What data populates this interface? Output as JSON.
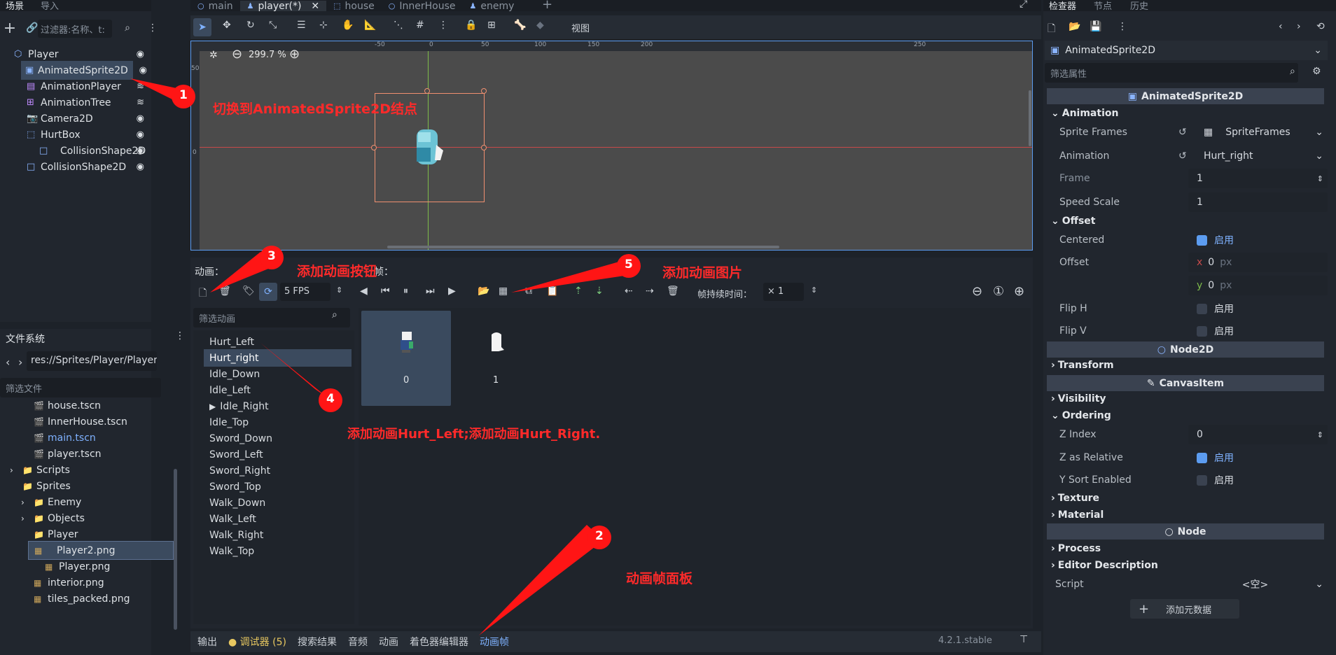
{
  "left_dock": {
    "tabs": [
      "场景",
      "导入"
    ],
    "filter_placeholder": "过滤器:名称、t:"
  },
  "scene_tree": [
    {
      "name": "Player",
      "icon": "node2d-icon",
      "level": 0,
      "visible": true
    },
    {
      "name": "AnimatedSprite2D",
      "icon": "animated-sprite-icon",
      "level": 1,
      "visible": true,
      "selected": true
    },
    {
      "name": "AnimationPlayer",
      "icon": "animation-player-icon",
      "level": 1,
      "visible": false
    },
    {
      "name": "AnimationTree",
      "icon": "animation-tree-icon",
      "level": 1,
      "visible": false
    },
    {
      "name": "Camera2D",
      "icon": "camera-icon",
      "level": 1,
      "visible": true
    },
    {
      "name": "HurtBox",
      "icon": "area2d-icon",
      "level": 1,
      "visible": true
    },
    {
      "name": "CollisionShape2D",
      "icon": "collision-shape-icon",
      "level": 2,
      "visible": true
    },
    {
      "name": "CollisionShape2D",
      "icon": "collision-shape-icon",
      "level": 1,
      "visible": true
    }
  ],
  "filesystem": {
    "title": "文件系统",
    "path": "res://Sprites/Player/Player",
    "filter_placeholder": "筛选文件",
    "items": [
      {
        "name": "house.tscn",
        "icon": "scene-icon",
        "level": 2
      },
      {
        "name": "InnerHouse.tscn",
        "icon": "scene-icon",
        "level": 2
      },
      {
        "name": "main.tscn",
        "icon": "scene-icon",
        "level": 2,
        "highlight": true
      },
      {
        "name": "player.tscn",
        "icon": "scene-icon",
        "level": 2
      },
      {
        "name": "Scripts",
        "icon": "folder-icon",
        "level": 1,
        "collapsed": true
      },
      {
        "name": "Sprites",
        "icon": "folder-icon",
        "level": 1
      },
      {
        "name": "Enemy",
        "icon": "folder-icon",
        "level": 2,
        "collapsed": true
      },
      {
        "name": "Objects",
        "icon": "folder-icon",
        "level": 2,
        "collapsed": true
      },
      {
        "name": "Player",
        "icon": "folder-icon",
        "level": 2
      },
      {
        "name": "Player2.png",
        "icon": "image-icon",
        "level": 3,
        "selected": true
      },
      {
        "name": "Player.png",
        "icon": "image-icon",
        "level": 3
      },
      {
        "name": "interior.png",
        "icon": "image-icon",
        "level": 2
      },
      {
        "name": "tiles_packed.png",
        "icon": "image-icon",
        "level": 2
      }
    ]
  },
  "editor_tabs": [
    "main",
    "player(*)",
    "house",
    "InnerHouse",
    "enemy"
  ],
  "viewport": {
    "toolbar_view": "视图",
    "zoom": "299.7 %",
    "ruler": [
      "-50",
      "0",
      "50",
      "100",
      "150",
      "200",
      "250"
    ],
    "ruler_v": [
      "50",
      "0"
    ]
  },
  "anim_panel": {
    "title": "动画：",
    "frames_label_partial": "帧：",
    "fps": "5 FPS",
    "frame_duration_label": "帧持续时间：",
    "frame_duration": "× 1",
    "filter_placeholder": "筛选动画",
    "animations": [
      "Hurt_Left",
      "Hurt_right",
      "Idle_Down",
      "Idle_Left",
      "Idle_Right",
      "Idle_Top",
      "Sword_Down",
      "Sword_Left",
      "Sword_Right",
      "Sword_Top",
      "Walk_Down",
      "Walk_Left",
      "Walk_Right",
      "Walk_Top"
    ],
    "selected_index": 1,
    "autoplay_index": 4,
    "frames": [
      "0",
      "1"
    ]
  },
  "bottom_bar": {
    "tabs": [
      "输出",
      "调试器 (5)",
      "搜索结果",
      "音频",
      "动画",
      "着色器编辑器",
      "动画帧"
    ],
    "version": "4.2.1.stable"
  },
  "inspector": {
    "tabs": [
      "检查器",
      "节点",
      "历史"
    ],
    "node": "AnimatedSprite2D",
    "filter_placeholder": "筛选属性",
    "sprite_frames": "SpriteFrames",
    "animation": "Hurt_right",
    "frame": "1",
    "speed_scale": "1",
    "centered": "启用",
    "offset_x": "0",
    "offset_y": "0",
    "px": "px",
    "on_label": "启用",
    "z_index": "0",
    "script_value": "<空>",
    "add_meta": "添加元数据",
    "labels": {
      "animated": "AnimatedSprite2D",
      "animation_sec": "Animation",
      "sprite_frames": "Sprite Frames",
      "animation": "Animation",
      "frame": "Frame",
      "speed_scale": "Speed Scale",
      "offset_sec": "Offset",
      "centered": "Centered",
      "offset": "Offset",
      "flip_h": "Flip H",
      "flip_v": "Flip V",
      "node2d": "Node2D",
      "transform": "Transform",
      "canvasitem": "CanvasItem",
      "visibility": "Visibility",
      "ordering": "Ordering",
      "z_index": "Z Index",
      "z_relative": "Z as Relative",
      "y_sort": "Y Sort Enabled",
      "texture": "Texture",
      "material": "Material",
      "node": "Node",
      "process": "Process",
      "editor_desc": "Editor Description",
      "script": "Script",
      "x": "x",
      "y": "y"
    }
  },
  "annotations": {
    "n1": "1",
    "n2": "2",
    "n3": "3",
    "n4": "4",
    "n5": "5",
    "a1": "切换到AnimatedSprite2D结点",
    "a3": "添加动画按钮",
    "a4": "添加动画Hurt_Left;添加动画Hurt_Right.",
    "a5": "添加动画图片",
    "a2": "动画帧面板"
  },
  "colors": {
    "accent": "#5c9cf0",
    "annotation": "#ff2a2a",
    "selection": "#3b4a5e"
  }
}
